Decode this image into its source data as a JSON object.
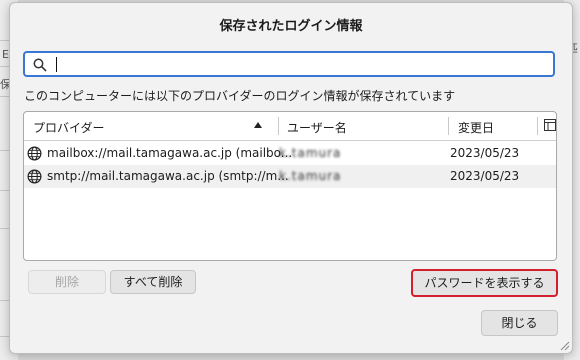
{
  "background": {
    "left_fragment_1": "E",
    "left_fragment_2": "保",
    "right_fragment_1": "匹",
    "right_fragment_2": "f"
  },
  "dialog": {
    "title": "保存されたログイン情報",
    "search": {
      "value": "",
      "placeholder": ""
    },
    "description": "このコンピューターには以下のプロバイダーのログイン情報が保存されています",
    "columns": {
      "provider": "プロバイダー",
      "username": "ユーザー名",
      "changed": "変更日"
    },
    "rows": [
      {
        "provider": "mailbox://mail.tamagawa.ac.jp (mailbo...",
        "username": "k.tamura",
        "date": "2023/05/23"
      },
      {
        "provider": "smtp://mail.tamagawa.ac.jp (smtp://m...",
        "username": "k.tamura",
        "date": "2023/05/23"
      }
    ],
    "buttons": {
      "delete": "削除",
      "delete_all": "すべて削除",
      "show_passwords": "パスワードを表示する",
      "close": "閉じる"
    },
    "colors": {
      "focus": "#3a77d5",
      "highlight_border": "#d2202c"
    }
  }
}
